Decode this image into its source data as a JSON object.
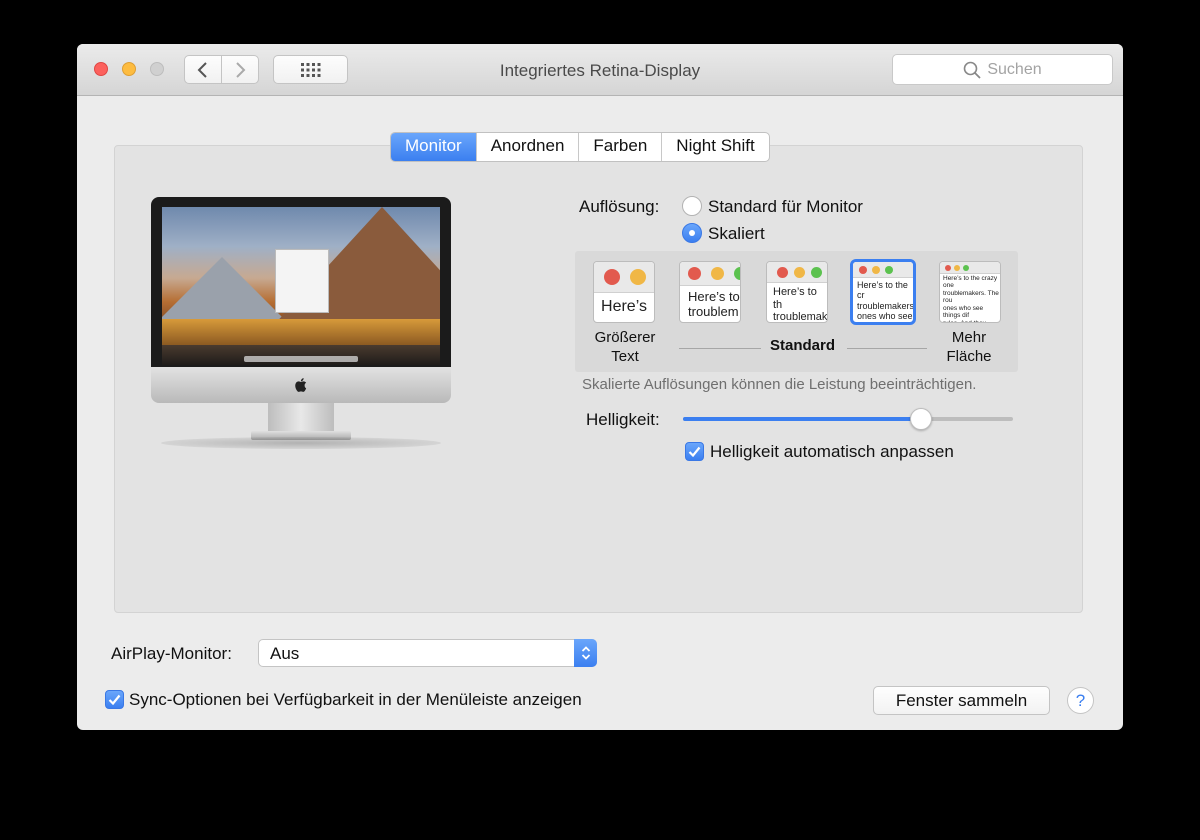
{
  "window": {
    "title": "Integriertes Retina-Display"
  },
  "toolbar": {
    "search_placeholder": "Suchen"
  },
  "tabs": [
    {
      "label": "Monitor",
      "active": true
    },
    {
      "label": "Anordnen",
      "active": false
    },
    {
      "label": "Farben",
      "active": false
    },
    {
      "label": "Night Shift",
      "active": false
    }
  ],
  "resolution": {
    "label": "Auflösung:",
    "options": [
      {
        "label": "Standard für Monitor",
        "selected": false
      },
      {
        "label": "Skaliert",
        "selected": true
      }
    ]
  },
  "scaling": {
    "thumbs": [
      {
        "text": "Here’s"
      },
      {
        "text": "Here’s to\ntroublem"
      },
      {
        "text": "Here’s to th\ntroublemak\nones who"
      },
      {
        "text": "Here’s to the cr\ntroublemakers.\nones who see t\nrules. And they",
        "selected": true
      },
      {
        "text": "Here’s to the crazy one\ntroublemakers. The rou\nones who see things dif\nrules. And they have no\ncan quote them, disagre\nthem. About the only th\nBecause they change th"
      }
    ],
    "larger_label_line1": "Größerer",
    "larger_label_line2": "Text",
    "standard_label": "Standard",
    "more_label_line1": "Mehr",
    "more_label_line2": "Fläche",
    "note": "Skalierte Auflösungen können die Leistung beeinträchtigen."
  },
  "brightness": {
    "label": "Helligkeit:",
    "value_percent": 72,
    "auto_label": "Helligkeit automatisch anpassen",
    "auto_checked": true
  },
  "airplay": {
    "label": "AirPlay-Monitor:",
    "value": "Aus"
  },
  "sync": {
    "label": "Sync-Optionen bei Verfügbarkeit in der Menüleiste anzeigen",
    "checked": true
  },
  "gather_button": "Fenster sammeln",
  "help_button": "?",
  "colors": {
    "accent": "#3b7ff0",
    "close": "#fc615d",
    "minimize": "#fdbc40"
  }
}
